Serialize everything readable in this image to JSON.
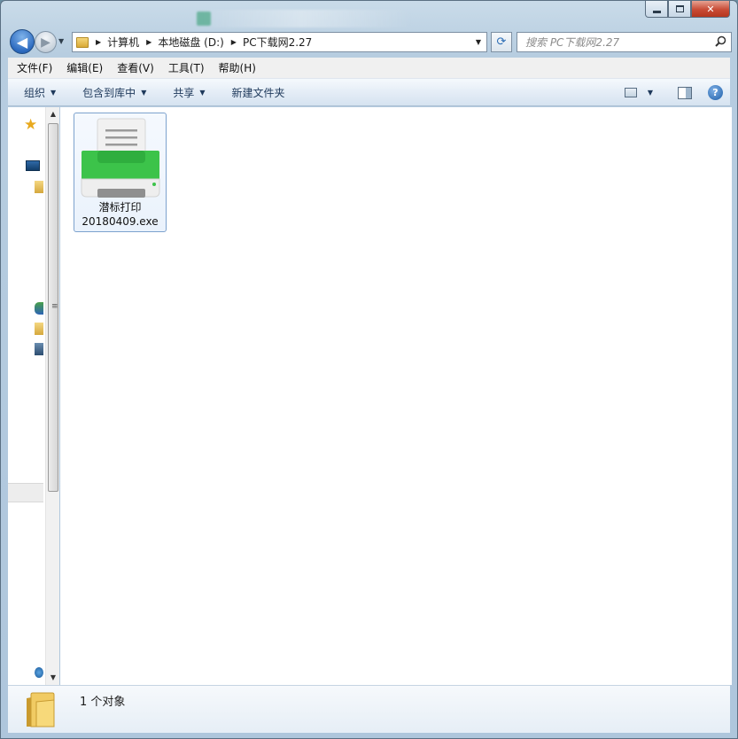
{
  "window": {
    "caption_minimize": "–",
    "caption_maximize": "□",
    "caption_close": "✕"
  },
  "nav": {
    "back_glyph": "◀",
    "forward_glyph": "▶",
    "breadcrumbs": [
      "计算机",
      "本地磁盘 (D:)",
      "PC下载网2.27"
    ],
    "search_placeholder": "搜索 PC下载网2.27"
  },
  "menu": [
    "文件(F)",
    "编辑(E)",
    "查看(V)",
    "工具(T)",
    "帮助(H)"
  ],
  "toolbar": {
    "organize": "组织",
    "include_in_library": "包含到库中",
    "share": "共享",
    "new_folder": "新建文件夹"
  },
  "files": [
    {
      "name_line1": "潜标打印",
      "name_line2": "20180409.exe",
      "icon": "printer-icon"
    }
  ],
  "status": {
    "item_count": "1 个对象"
  },
  "colors": {
    "printer_green": "#3cc34a",
    "accent_blue": "#2d6bc0",
    "close_red": "#c84b35"
  }
}
